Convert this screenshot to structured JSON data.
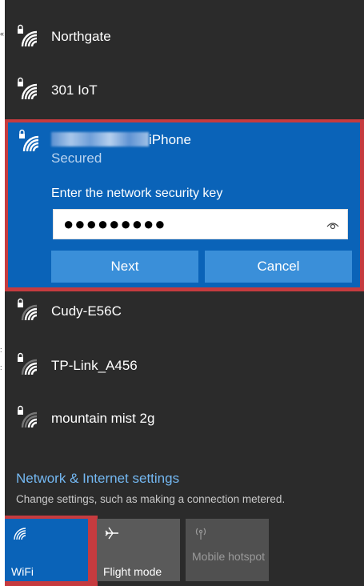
{
  "networks_top": [
    {
      "name": "Northgate"
    },
    {
      "name": "301 IoT"
    }
  ],
  "selected_network": {
    "name_visible": "iPhone",
    "status": "Secured",
    "prompt": "Enter the network security key",
    "password_value": "●●●●●●●●●",
    "next_label": "Next",
    "cancel_label": "Cancel"
  },
  "networks_bottom": [
    {
      "name": "Cudy-E56C"
    },
    {
      "name": "TP-Link_A456"
    },
    {
      "name": "mountain mist 2g"
    }
  ],
  "settings": {
    "link": "Network & Internet settings",
    "description": "Change settings, such as making a connection metered."
  },
  "quick_actions": [
    {
      "label": "WiFi",
      "icon": "wifi-icon",
      "state": "on"
    },
    {
      "label": "Flight mode",
      "icon": "airplane-icon",
      "state": "off"
    },
    {
      "label": "Mobile hotspot",
      "icon": "hotspot-icon",
      "state": "disabled"
    }
  ],
  "colors": {
    "panel_bg": "#2b2b2b",
    "accent": "#0a63b8",
    "highlight_border": "#c63b3f",
    "link": "#74b8f2"
  }
}
